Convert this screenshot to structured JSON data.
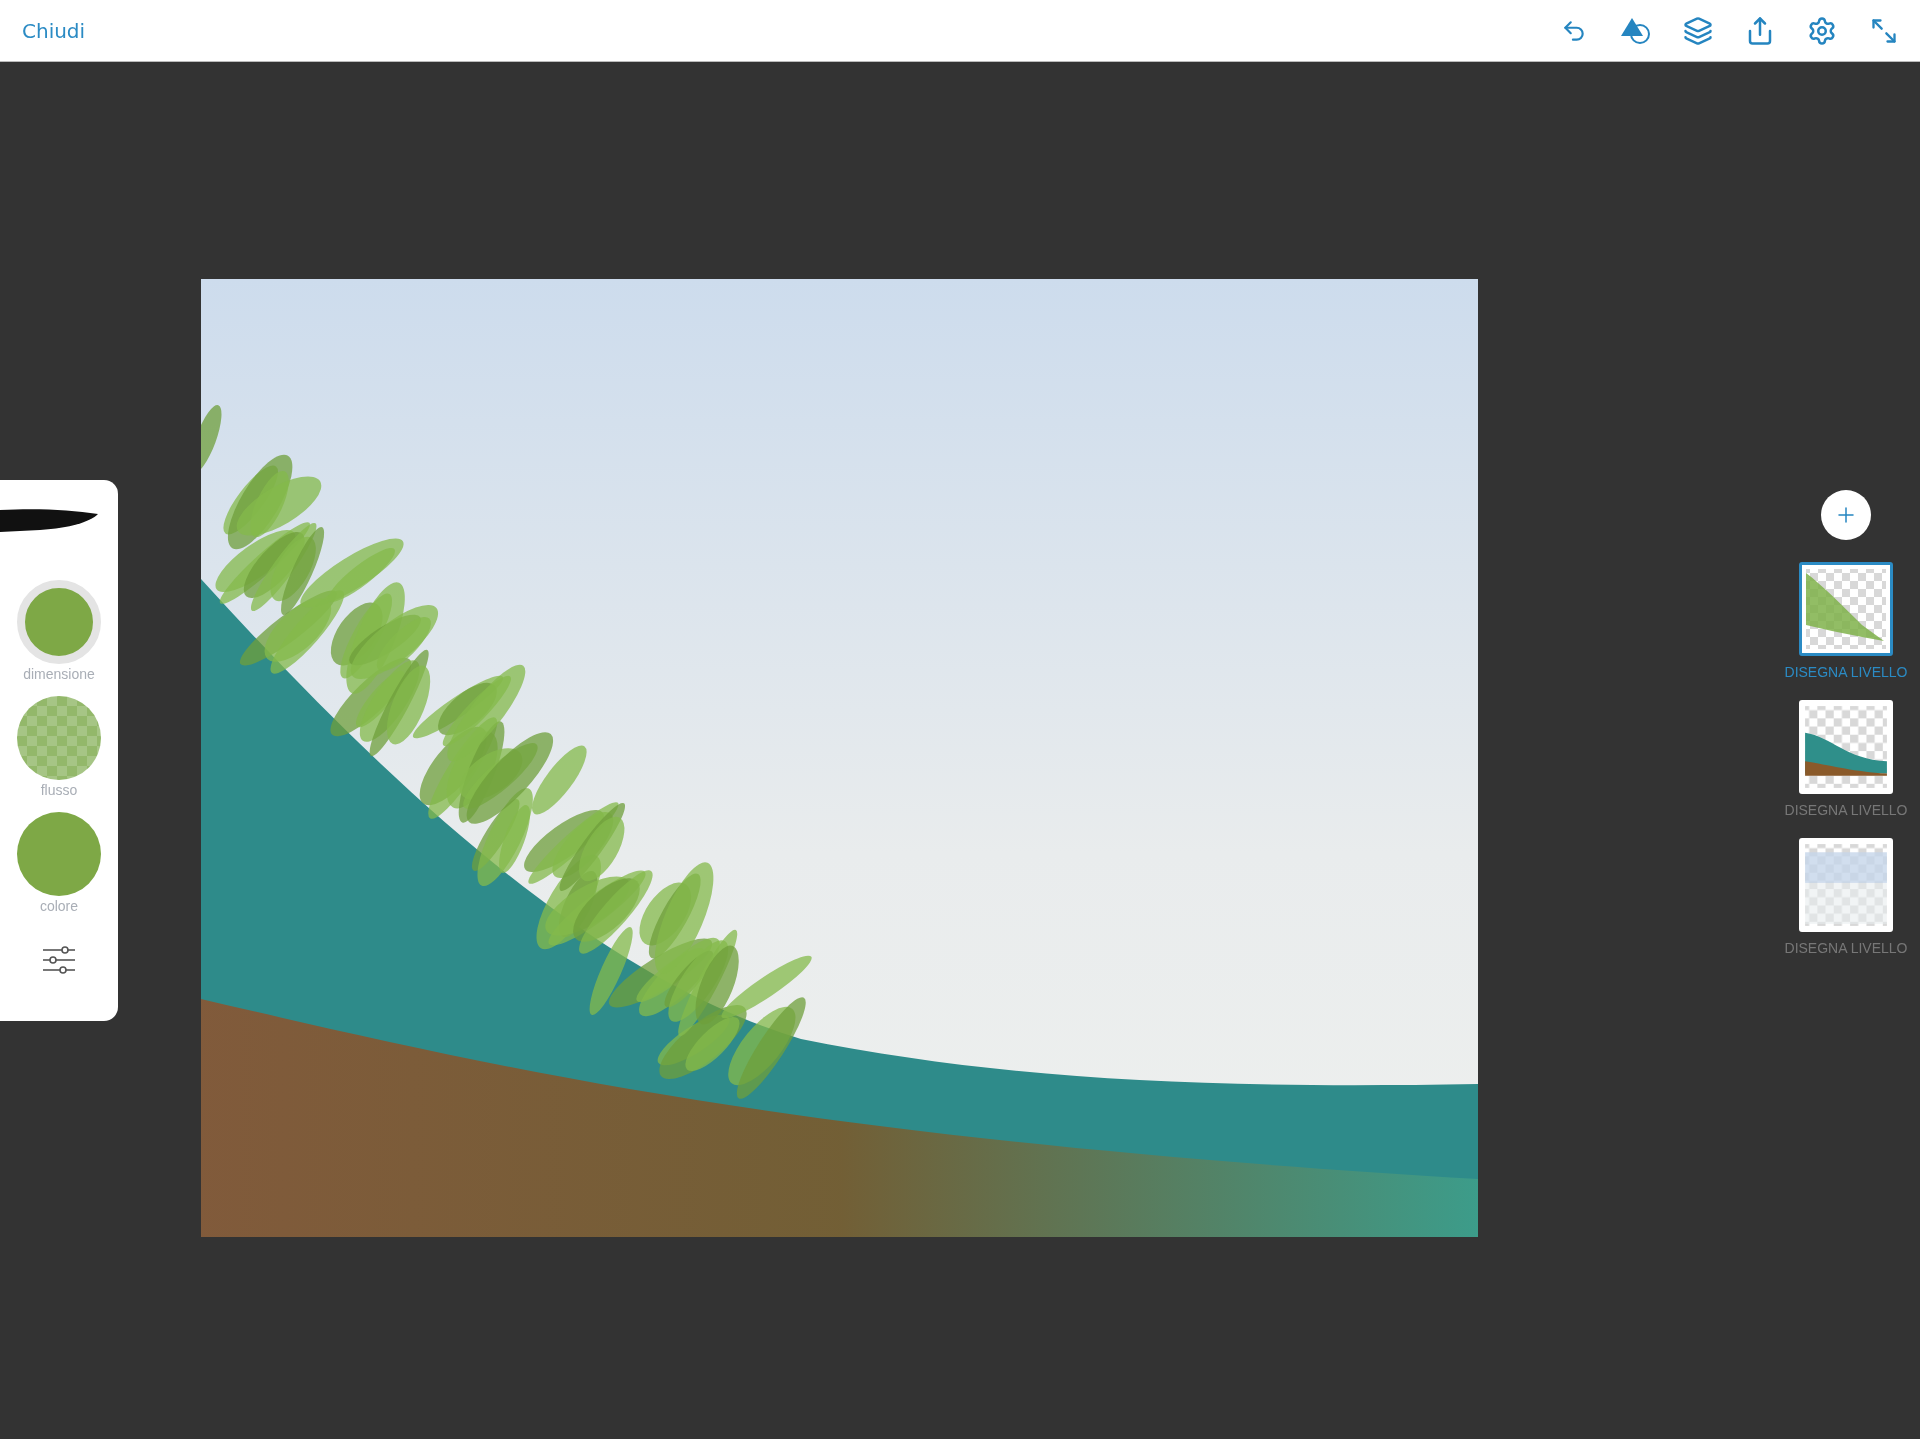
{
  "top_bar": {
    "close_label": "Chiudi"
  },
  "brush_panel": {
    "controls": [
      {
        "kind": "size",
        "label": "dimensione",
        "color": "#7ea846"
      },
      {
        "kind": "flow",
        "label": "flusso",
        "color": "#93b86a"
      },
      {
        "kind": "color",
        "label": "colore",
        "color": "#7ea846"
      }
    ]
  },
  "layers": [
    {
      "kind": "grass",
      "label": "DISEGNA LIVELLO",
      "selected": true
    },
    {
      "kind": "hill",
      "label": "DISEGNA LIVELLO",
      "selected": false
    },
    {
      "kind": "sky",
      "label": "DISEGNA LIVELLO",
      "selected": false
    }
  ]
}
